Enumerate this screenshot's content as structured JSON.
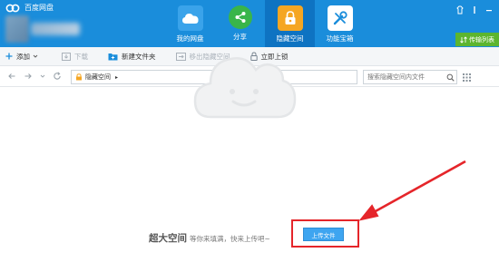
{
  "app": {
    "title": "百度网盘"
  },
  "nav": {
    "tabs": [
      {
        "label": "我的网盘",
        "icon": "cloud-icon"
      },
      {
        "label": "分享",
        "icon": "share-icon"
      },
      {
        "label": "隐藏空间",
        "icon": "lock-icon",
        "active": true
      },
      {
        "label": "功能宝箱",
        "icon": "toolbox-icon"
      }
    ],
    "transfer_label": "传输列表"
  },
  "toolbar": {
    "add_label": "添加",
    "download_label": "下载",
    "new_folder_label": "新建文件夹",
    "move_out_label": "移出隐藏空间",
    "lock_now_label": "立即上锁"
  },
  "address": {
    "path": "隐藏空间",
    "search_placeholder": "搜索隐藏空间内文件"
  },
  "empty_state": {
    "headline": "超大空间",
    "subtext": "等你来填满，快来上传吧~",
    "upload_label": "上传文件"
  },
  "colors": {
    "topbar": "#1a8ddb",
    "active_tab": "#0e73c2",
    "transfer_button": "#5cb52f",
    "upload_button": "#3ea5f0",
    "annotation": "#e5252a"
  }
}
